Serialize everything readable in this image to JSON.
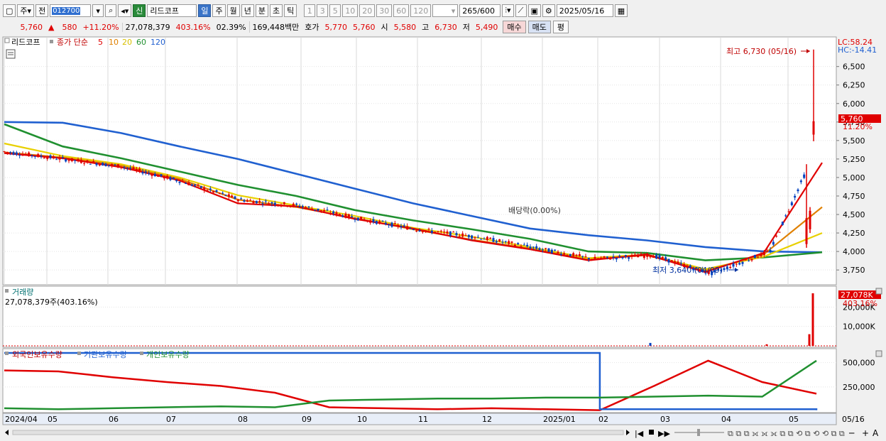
{
  "toolbar": {
    "period_main": "주",
    "prev_label": "전",
    "code": "012700",
    "new_badge": "신",
    "stock_name": "리드코프",
    "periods": [
      "일",
      "주",
      "월",
      "년",
      "분",
      "초",
      "틱"
    ],
    "active_period": "일",
    "intervals": [
      "1",
      "3",
      "5",
      "10",
      "20",
      "30",
      "60",
      "120"
    ],
    "count": "265",
    "count_total": "/600",
    "date": "2025/05/16"
  },
  "quote": {
    "price": "5,760",
    "change": "580",
    "change_pct": "+11.20%",
    "volume": "27,078,379",
    "volume_ratio": "403.16%",
    "turnover": "02.39%",
    "amount": "169,448백만",
    "ask_label": "호가",
    "ask1": "5,770",
    "ask2": "5,760",
    "open_label": "시",
    "open": "5,580",
    "high_label": "고",
    "high": "6,730",
    "low_label": "저",
    "low": "5,490",
    "buy_label": "매수",
    "sell_label": "매도",
    "eval_label": "평"
  },
  "legend": {
    "stock": "리드코프",
    "close_label": "종가 단순",
    "ma": [
      "5",
      "10",
      "20",
      "60",
      "120"
    ],
    "ma_colors": [
      "#e00000",
      "#e08000",
      "#e8d000",
      "#209030",
      "#2060d0"
    ]
  },
  "colors": {
    "up": "#e00000",
    "down": "#0040c0",
    "foreign": "#e00000",
    "institution": "#2060d0",
    "individual": "#209030",
    "background": "#ffffff"
  },
  "indicators": {
    "lc": "LC:58.24",
    "hc": "HC:-14.41",
    "high_annotation": "최고 6,730 (05/16)",
    "low_annotation": "최저 3,640 (04/09)",
    "dividend": "배당락(0.00%)",
    "last_price_tag": "5,760",
    "last_pct_tag": "11.20%"
  },
  "volume_panel": {
    "title": "거래량",
    "value": "27,078,379주(403.16%)",
    "last_tag": "27,078K",
    "last_pct": "403.16%"
  },
  "holdings_panel": {
    "foreign": "외국인보유수량",
    "institution": "기관보유수량",
    "individual": "개인보유수량"
  },
  "xaxis_last": "05/16",
  "chart_data": [
    {
      "type": "line",
      "name": "price",
      "x": [
        "2024/04",
        "05",
        "06",
        "07",
        "08",
        "09",
        "10",
        "11",
        "12",
        "2025/01",
        "02",
        "03",
        "04",
        "05"
      ],
      "series": [
        {
          "name": "종가",
          "values": [
            5350,
            5250,
            5150,
            4950,
            4700,
            4620,
            4450,
            4300,
            4200,
            4050,
            3900,
            3950,
            3700,
            4000,
            5760
          ]
        },
        {
          "name": "5",
          "values": [
            5330,
            5260,
            5140,
            4960,
            4650,
            4610,
            4440,
            4310,
            4150,
            4030,
            3880,
            3960,
            3720,
            3980,
            5200
          ]
        },
        {
          "name": "10",
          "values": [
            5340,
            5270,
            5160,
            4980,
            4700,
            4600,
            4450,
            4300,
            4160,
            4040,
            3890,
            3950,
            3740,
            3960,
            4600
          ]
        },
        {
          "name": "20",
          "values": [
            5460,
            5290,
            5180,
            5000,
            4760,
            4620,
            4480,
            4320,
            4200,
            4060,
            3910,
            3960,
            3760,
            3930,
            4250
          ]
        },
        {
          "name": "60",
          "values": [
            5720,
            5420,
            5260,
            5080,
            4900,
            4750,
            4560,
            4420,
            4300,
            4170,
            4000,
            3980,
            3880,
            3920,
            3990
          ]
        },
        {
          "name": "120",
          "values": [
            5750,
            5740,
            5600,
            5420,
            5250,
            5050,
            4850,
            4650,
            4480,
            4310,
            4220,
            4150,
            4060,
            4000,
            3990
          ]
        }
      ],
      "ylim": [
        3550,
        6900
      ],
      "yticks": [
        3750,
        4000,
        4250,
        4500,
        4750,
        5000,
        5250,
        5500,
        5750,
        6000,
        6250,
        6500
      ]
    },
    {
      "type": "bar",
      "name": "volume",
      "yticks_labels": [
        "10,000K",
        "20,000K"
      ],
      "ylim": [
        0,
        30000
      ],
      "spikes_k": [
        {
          "x": "2025/02",
          "v": 1500
        },
        {
          "x": "2025/04",
          "v": 800
        },
        {
          "x": "2025/05",
          "v": 6000
        },
        {
          "x": "05/16",
          "v": 27078
        }
      ]
    },
    {
      "type": "line",
      "name": "holdings",
      "yticks": [
        250000,
        500000
      ],
      "ylim": [
        0,
        600000
      ],
      "series": [
        {
          "name": "외국인보유수량",
          "values": [
            420000,
            410000,
            350000,
            300000,
            260000,
            190000,
            40000,
            30000,
            20000,
            30000,
            20000,
            10000,
            260000,
            520000,
            300000,
            180000
          ]
        },
        {
          "name": "기관보유수량",
          "values": [
            600000,
            600000,
            600000,
            600000,
            600000,
            600000,
            600000,
            600000,
            600000,
            600000,
            600000,
            20000,
            20000,
            20000,
            20000,
            10000
          ]
        },
        {
          "name": "개인보유수량",
          "values": [
            30000,
            20000,
            30000,
            40000,
            50000,
            40000,
            110000,
            120000,
            130000,
            130000,
            140000,
            140000,
            150000,
            160000,
            150000,
            520000
          ]
        }
      ]
    }
  ]
}
